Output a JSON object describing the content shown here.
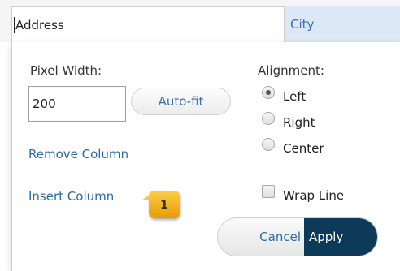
{
  "columns": {
    "address_value": "Address",
    "city_label": "City"
  },
  "panel": {
    "pixel_width_label": "Pixel Width:",
    "pixel_width_value": "200",
    "autofit_label": "Auto-fit",
    "remove_column_label": "Remove Column",
    "insert_column_label": "Insert Column",
    "alignment_label": "Alignment:",
    "alignment_options": [
      "Left",
      "Right",
      "Center"
    ],
    "alignment_selected": "Left",
    "wrap_line_label": "Wrap Line",
    "wrap_line_checked": false,
    "cancel_label": "Cancel",
    "apply_label": "Apply"
  },
  "callout": {
    "number": "1"
  },
  "colors": {
    "link": "#2e6aa8",
    "apply_bg": "#0e3a5a",
    "city_header_bg": "#dce8f6",
    "badge": "#f2b01e"
  }
}
